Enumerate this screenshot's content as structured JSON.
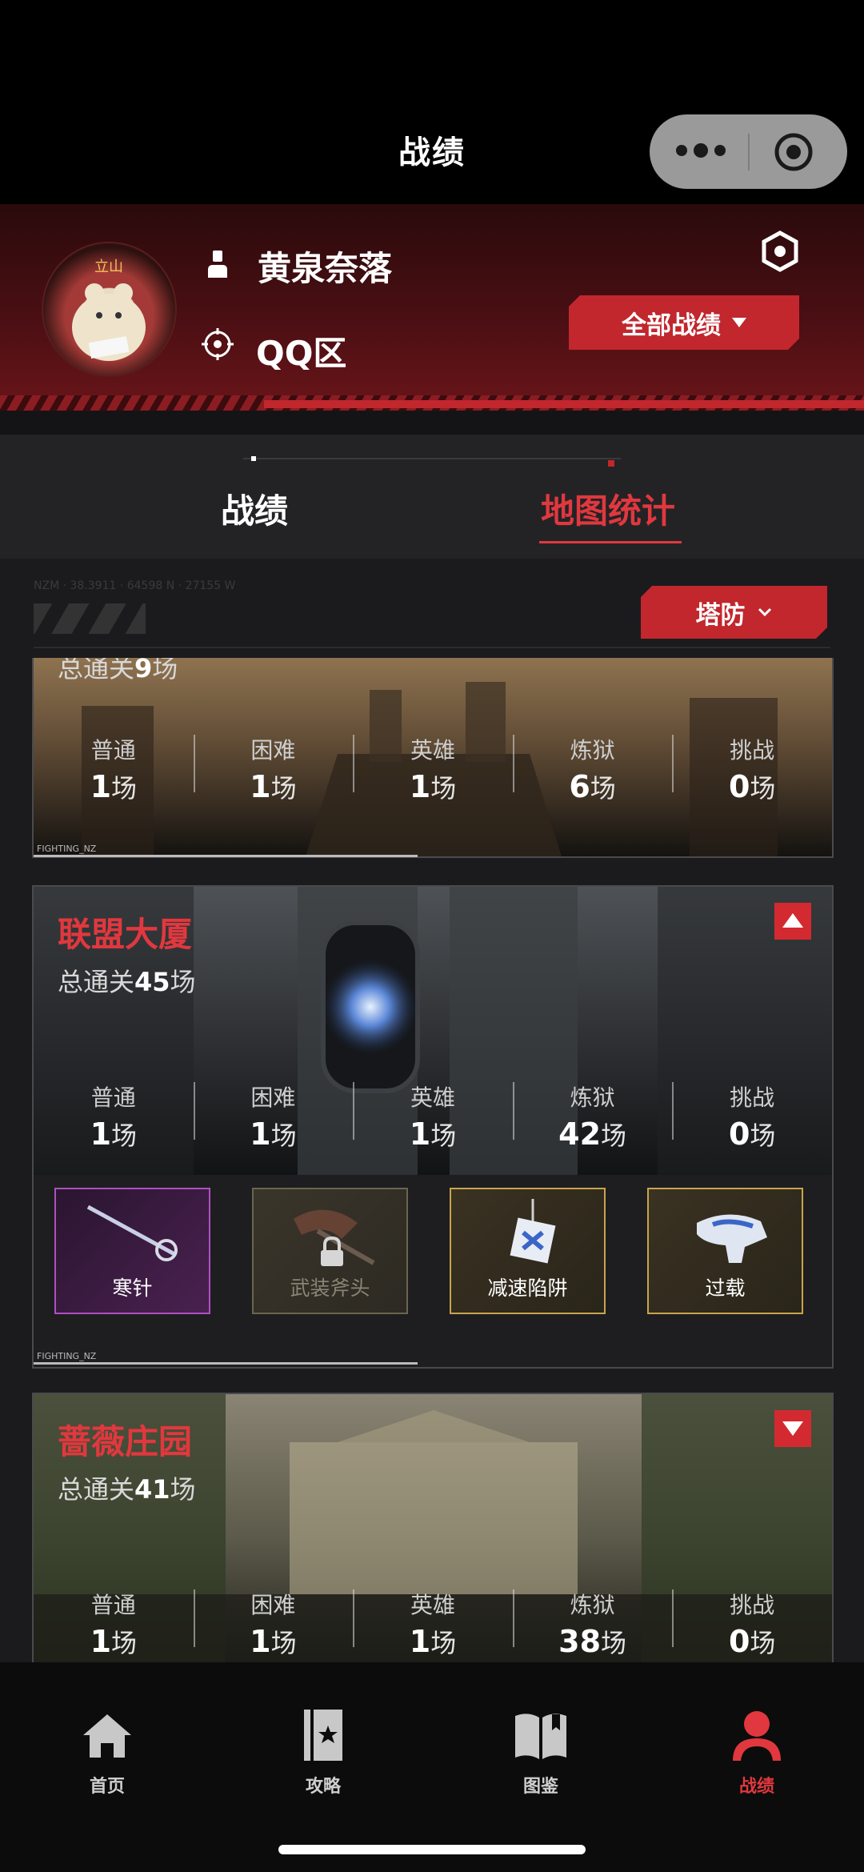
{
  "header": {
    "title": "战绩"
  },
  "profile": {
    "username": "黄泉奈落",
    "server": "QQ区",
    "all_records_label": "全部战绩"
  },
  "tabs": [
    {
      "label": "战绩",
      "active": false
    },
    {
      "label": "地图统计",
      "active": true
    }
  ],
  "filter": {
    "deco_text": "NZM · 38.3911 · 64598 N · 27155 W",
    "mode_label": "塔防"
  },
  "stat_labels": [
    "普通",
    "困难",
    "英雄",
    "炼狱",
    "挑战"
  ],
  "unit": "场",
  "maps": [
    {
      "name": "",
      "total_prefix": "总通关",
      "total": "9",
      "stats": [
        "1",
        "1",
        "1",
        "6",
        "0"
      ],
      "footer_tag": "FIGHTING_NZ"
    },
    {
      "name": "联盟大厦",
      "total_prefix": "总通关",
      "total": "45",
      "expanded": true,
      "stats": [
        "1",
        "1",
        "1",
        "42",
        "0"
      ],
      "weapons": [
        {
          "name": "寒针",
          "rarity": "purple"
        },
        {
          "name": "武装斧头",
          "rarity": "locked"
        },
        {
          "name": "减速陷阱",
          "rarity": "gold"
        },
        {
          "name": "过载",
          "rarity": "gold"
        }
      ],
      "footer_tag": "FIGHTING_NZ"
    },
    {
      "name": "蔷薇庄园",
      "total_prefix": "总通关",
      "total": "41",
      "expanded": false,
      "stats": [
        "1",
        "1",
        "1",
        "38",
        "0"
      ]
    }
  ],
  "nav": [
    {
      "label": "首页",
      "icon": "home-icon",
      "active": false
    },
    {
      "label": "攻略",
      "icon": "guide-book-icon",
      "active": false
    },
    {
      "label": "图鉴",
      "icon": "codex-icon",
      "active": false
    },
    {
      "label": "战绩",
      "icon": "profile-icon",
      "active": true
    }
  ],
  "colors": {
    "accent": "#c1272d",
    "accent_text": "#e0383e",
    "bg": "#1b1b1d"
  }
}
